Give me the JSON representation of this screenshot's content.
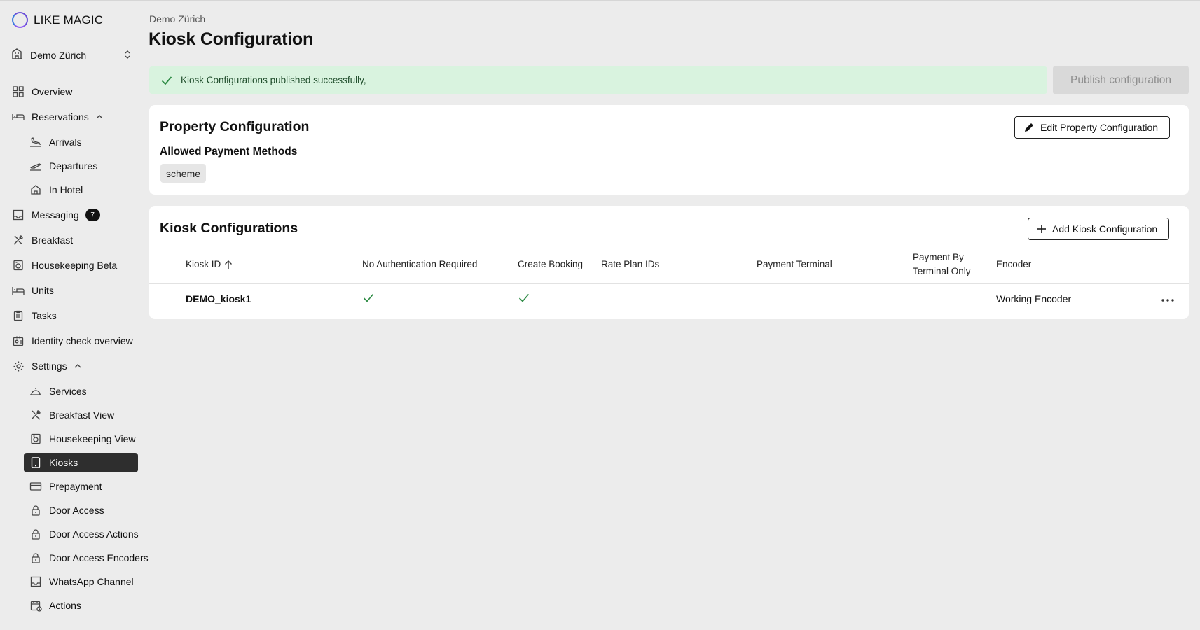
{
  "app": {
    "logo_text": "LIKE MAGIC"
  },
  "property_selector": {
    "label": "Demo Zürich"
  },
  "nav": {
    "overview": "Overview",
    "reservations": "Reservations",
    "arrivals": "Arrivals",
    "departures": "Departures",
    "in_hotel": "In Hotel",
    "messaging": "Messaging",
    "messaging_badge": "7",
    "breakfast": "Breakfast",
    "housekeeping": "Housekeeping Beta",
    "units": "Units",
    "tasks": "Tasks",
    "identity_check": "Identity check overview",
    "settings": "Settings",
    "services": "Services",
    "breakfast_view": "Breakfast View",
    "housekeeping_view": "Housekeeping View",
    "kiosks": "Kiosks",
    "prepayment": "Prepayment",
    "door_access": "Door Access",
    "door_access_actions": "Door Access Actions",
    "door_access_encoders": "Door Access Encoders",
    "whatsapp_channel": "WhatsApp Channel",
    "actions": "Actions"
  },
  "breadcrumb": "Demo Zürich",
  "page_title": "Kiosk Configuration",
  "alert": {
    "message": "Kiosk Configurations published successfully,"
  },
  "publish_button": "Publish configuration",
  "property_config": {
    "title": "Property Configuration",
    "edit_button": "Edit Property Configuration",
    "payment_methods_label": "Allowed Payment Methods",
    "payment_methods": [
      "scheme"
    ]
  },
  "kiosk_configs": {
    "title": "Kiosk Configurations",
    "add_button": "Add Kiosk Configuration",
    "columns": {
      "kiosk_id": "Kiosk ID",
      "no_auth": "No Authentication Required",
      "create_booking": "Create Booking",
      "rate_plan_ids": "Rate Plan IDs",
      "payment_terminal": "Payment Terminal",
      "payment_by_terminal_line1": "Payment By",
      "payment_by_terminal_line2": "Terminal Only",
      "encoder": "Encoder"
    },
    "rows": [
      {
        "kiosk_id": "DEMO_kiosk1",
        "no_auth": true,
        "create_booking": true,
        "rate_plan_ids": "",
        "payment_terminal": "",
        "payment_by_terminal_only": "",
        "encoder": "Working Encoder"
      }
    ]
  },
  "colors": {
    "background": "#ececec",
    "success_bg": "#d9f3df",
    "success_check": "#2e8b45",
    "active_nav": "#2e2e2e"
  }
}
